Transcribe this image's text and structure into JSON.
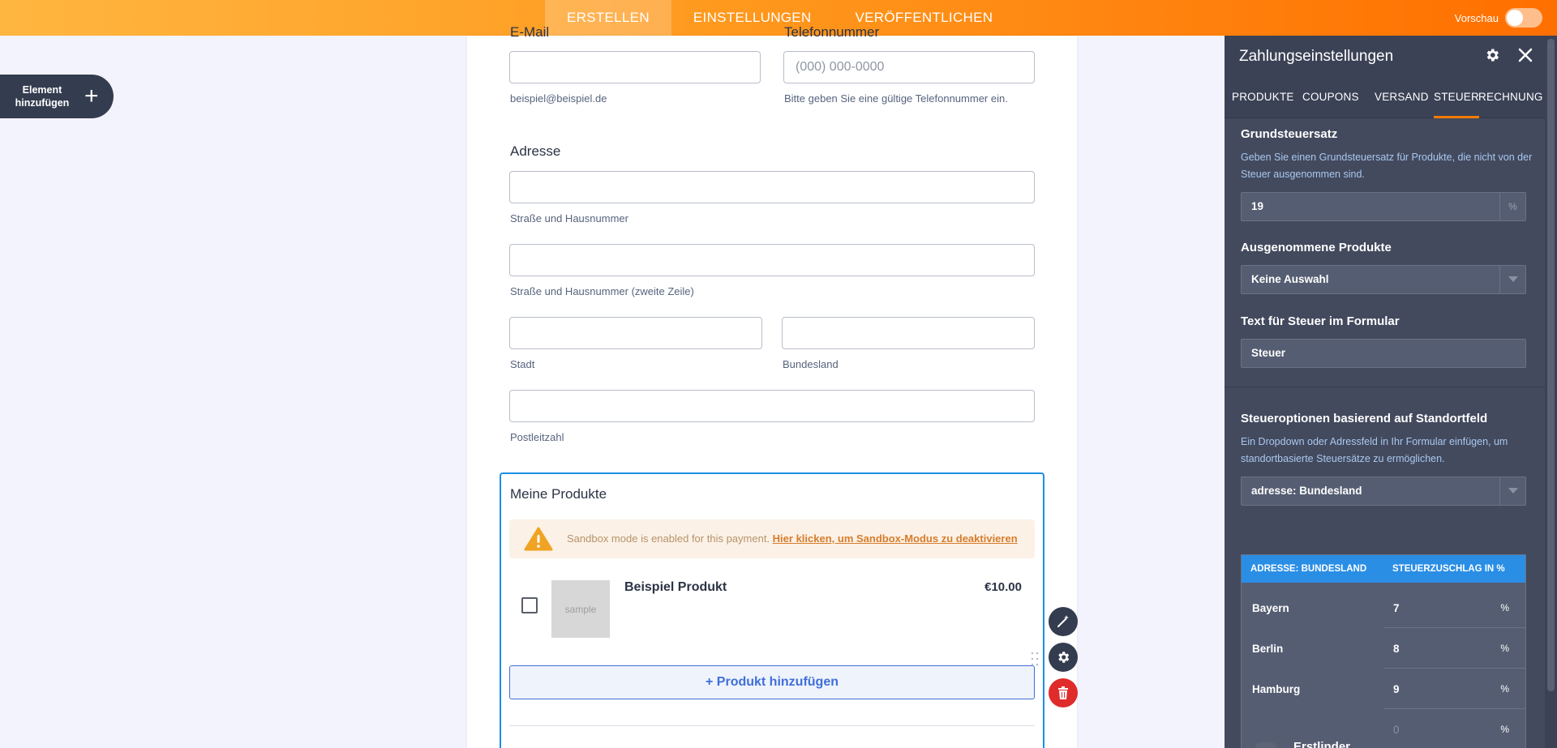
{
  "topbar": {
    "tabs": [
      {
        "label": "ERSTELLEN",
        "active": true
      },
      {
        "label": "EINSTELLUNGEN",
        "active": false
      },
      {
        "label": "VERÖFFENTLICHEN",
        "active": false
      }
    ],
    "preview_label": "Vorschau",
    "preview_on": false
  },
  "add_element": {
    "line1": "Element",
    "line2": "hinzufügen"
  },
  "form": {
    "email_label": "E-Mail",
    "phone_label": "Telefonnummer",
    "email_value": "",
    "email_sub": "beispiel@beispiel.de",
    "phone_placeholder": "(000) 000-0000",
    "phone_sub": "Bitte geben Sie eine gültige Telefonnummer ein.",
    "address_label": "Adresse",
    "street1_sub": "Straße und Hausnummer",
    "street2_sub": "Straße und Hausnummer (zweite Zeile)",
    "city_sub": "Stadt",
    "state_sub": "Bundesland",
    "zip_sub": "Postleitzahl",
    "products": {
      "title": "Meine Produkte",
      "sandbox_text": "Sandbox mode is enabled for this payment.",
      "sandbox_link": "Hier klicken, um Sandbox-Modus zu deaktivieren",
      "thumb_text": "sample",
      "product_name": "Beispiel Produkt",
      "product_price": "€10.00",
      "add_product": "+ Produkt hinzufügen"
    }
  },
  "panel": {
    "title": "Zahlungseinstellungen",
    "tabs": [
      "PRODUKTE",
      "COUPONS",
      "VERSAND",
      "STEUER",
      "RECHNUNG"
    ],
    "active_tab": "STEUER",
    "base_tax": {
      "title": "Grundsteuersatz",
      "desc": "Geben Sie einen Grundsteuersatz für Produkte, die nicht von der Steuer ausgenommen sind.",
      "value": "19",
      "suffix": "%"
    },
    "exempt": {
      "title": "Ausgenommene Produkte",
      "value": "Keine Auswahl"
    },
    "tax_text": {
      "title": "Text für Steuer im Formular",
      "value": "Steuer"
    },
    "location": {
      "title": "Steueroptionen basierend auf Standortfeld",
      "desc": "Ein Dropdown oder Adressfeld in Ihr Formular einfügen, um standortbasierte Steuersätze zu ermöglichen.",
      "value": "adresse: Bundesland",
      "table": {
        "col1": "ADRESSE: BUNDESLAND",
        "col2": "STEUERZUSCHLAG IN %",
        "rows": [
          {
            "name": "Bayern",
            "value": "7",
            "pct": "%"
          },
          {
            "name": "Berlin",
            "value": "8",
            "pct": "%"
          },
          {
            "name": "Hamburg",
            "value": "9",
            "pct": "%"
          },
          {
            "name": "",
            "value": "0",
            "pct": "%"
          }
        ]
      }
    },
    "next_section_peek": "Erstlinder"
  },
  "colors": {
    "accent": "#ff7a00",
    "selection": "#1b8fe6",
    "panel_bg": "#434a5e",
    "table_header": "#2a8ee5",
    "delete": "#e02b2b"
  }
}
